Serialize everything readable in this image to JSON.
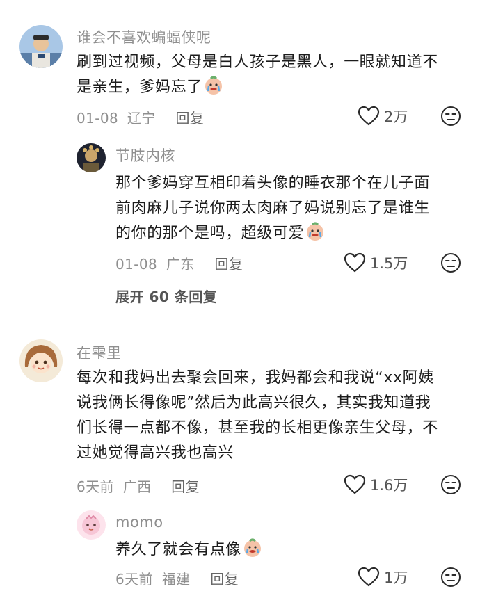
{
  "comments": [
    {
      "username": "谁会不喜欢蝙蝠侠呢",
      "lines": [
        "刷到过视频，父母是白人孩子是黑人，一眼就知道不",
        "是亲生，爹妈忘了"
      ],
      "trailing_emoji": "crying-face-emoji",
      "date": "01-08",
      "region": "辽宁",
      "reply_label": "回复",
      "likes": "2万",
      "reply": {
        "username": "节肢内核",
        "lines": [
          "那个爹妈穿互相印着头像的睡衣那个在儿子面",
          "前肉麻儿子说你两太肉麻了妈说别忘了是谁生",
          "的你的那个是吗，超级可爱"
        ],
        "trailing_emoji": "crying-face-emoji",
        "date": "01-08",
        "region": "广东",
        "reply_label": "回复",
        "likes": "1.5万"
      },
      "expand_label": "展开 60 条回复"
    },
    {
      "username": "在雫里",
      "lines": [
        "每次和我妈出去聚会回来，我妈都会和我说“xx阿姨",
        "说我俩长得像呢”然后为此高兴很久，其实我知道我",
        "们长得一点都不像，甚至我的长相更像亲生父母，不",
        "过她觉得高兴我也高兴"
      ],
      "date": "6天前",
      "region": "广西",
      "reply_label": "回复",
      "likes": "1.6万",
      "reply": {
        "username": "momo",
        "lines": [
          "养久了就会有点像"
        ],
        "trailing_emoji": "crying-face-emoji",
        "date": "6天前",
        "region": "福建",
        "reply_label": "回复",
        "likes": "1万"
      }
    }
  ],
  "icons": {
    "like": "heart-outline-icon",
    "dislike": "unamused-face-icon"
  },
  "colors": {
    "text_primary": "#1c1c1c",
    "text_secondary": "#8f8f8f",
    "icon": "#2a2a2a"
  }
}
